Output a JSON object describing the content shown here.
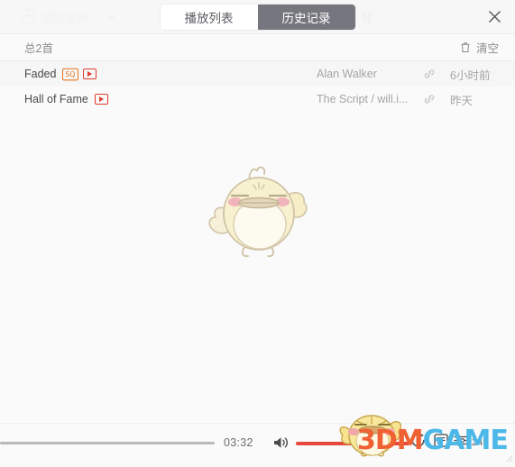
{
  "header": {
    "ghost_play_all": "播放全部",
    "ghost_plus": "+",
    "ghost_right_text": "部",
    "tabs": [
      {
        "label": "播放列表",
        "active": false
      },
      {
        "label": "历史记录",
        "active": true
      }
    ],
    "close_label": "×"
  },
  "list_header": {
    "total_text": "总2首",
    "clear_label": "清空"
  },
  "songs": [
    {
      "title": "Faded",
      "badges": [
        "SQ",
        "MV"
      ],
      "sq_label": "SQ",
      "artist": "Alan Walker",
      "time_ago": "6小时前"
    },
    {
      "title": "Hall of Fame",
      "badges": [
        "MV"
      ],
      "sq_label": "",
      "artist": "The Script / will.i...",
      "time_ago": "昨天"
    }
  ],
  "player": {
    "current_time": "03:32",
    "progress_percent": 42,
    "volume_percent": 100,
    "queue_count": "245"
  },
  "watermark": {
    "part1": "3DM",
    "part2": "GAME"
  },
  "colors": {
    "accent_red": "#e8483c",
    "badge_sq": "#e8731e",
    "badge_mv": "#e23b2e",
    "tab_active_bg": "#76767f",
    "background": "#fafafa",
    "watermark_orange": "#ef6133",
    "watermark_blue": "#4bb8e8"
  }
}
